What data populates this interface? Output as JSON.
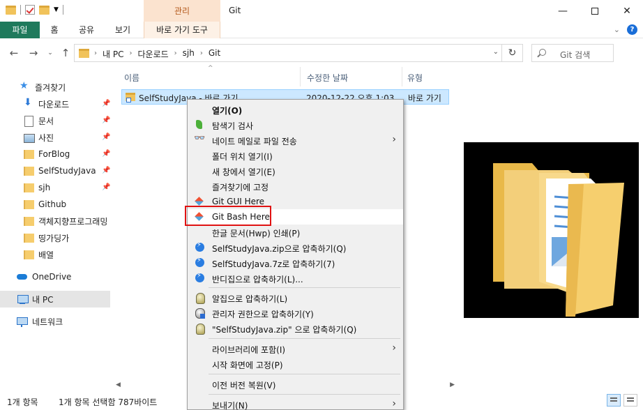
{
  "window": {
    "context_tab_title": "관리",
    "title": "Git",
    "minimize_icon": "minimize-icon",
    "maximize_icon": "maximize-icon",
    "close_icon": "close-icon"
  },
  "ribbon": {
    "tabs": [
      {
        "label": "파일"
      },
      {
        "label": "홈"
      },
      {
        "label": "공유"
      },
      {
        "label": "보기"
      },
      {
        "label": "바로 가기 도구"
      }
    ]
  },
  "address": {
    "crumbs": [
      "내 PC",
      "다운로드",
      "sjh",
      "Git"
    ],
    "search_placeholder": "Git 검색"
  },
  "sidebar": {
    "items": [
      {
        "label": "즐겨찾기",
        "icon": "star-icon"
      },
      {
        "label": "다운로드",
        "icon": "download-icon"
      },
      {
        "label": "문서",
        "icon": "document-icon"
      },
      {
        "label": "사진",
        "icon": "pictures-icon"
      },
      {
        "label": "ForBlog",
        "icon": "folder-icon"
      },
      {
        "label": "SelfStudyJava",
        "icon": "folder-icon"
      },
      {
        "label": "sjh",
        "icon": "folder-icon"
      },
      {
        "label": "Github",
        "icon": "folder-icon"
      },
      {
        "label": "객체지향프로그래밍",
        "icon": "folder-icon"
      },
      {
        "label": "띵가딩가",
        "icon": "folder-icon"
      },
      {
        "label": "배열",
        "icon": "folder-icon"
      },
      {
        "label": "OneDrive",
        "icon": "onedrive-icon"
      },
      {
        "label": "내 PC",
        "icon": "pc-icon"
      },
      {
        "label": "네트워크",
        "icon": "network-icon"
      }
    ]
  },
  "filelist": {
    "columns": [
      "이름",
      "수정한 날짜",
      "유형"
    ],
    "rows": [
      {
        "name": "SelfStudyJava - 바로 가기",
        "modified": "2020-12-22 오후 1:03",
        "type": "바로 가기"
      }
    ]
  },
  "status": {
    "count": "1개 항목",
    "selected": "1개 항목 선택함 787바이트"
  },
  "context_menu": {
    "items": [
      {
        "label": "열기(O)",
        "icon": ""
      },
      {
        "label": "탐색기 검사",
        "icon": "scan-icon"
      },
      {
        "label": "네이트 메일로 파일 전송",
        "icon": "nate-mail-icon"
      },
      {
        "label": "폴더 위치 열기(I)",
        "icon": ""
      },
      {
        "label": "새 창에서 열기(E)",
        "icon": ""
      },
      {
        "label": "즐겨찾기에 고정",
        "icon": ""
      },
      {
        "label": "Git GUI Here",
        "icon": "git-icon"
      },
      {
        "label": "Git Bash Here",
        "icon": "git-icon"
      },
      {
        "label": "한글 문서(Hwp) 인쇄(P)",
        "icon": ""
      },
      {
        "label": "SelfStudyJava.zip으로 압축하기(Q)",
        "icon": "bandizip-icon"
      },
      {
        "label": "SelfStudyJava.7z로 압축하기(7)",
        "icon": "bandizip-icon"
      },
      {
        "label": "반디집으로 압축하기(L)...",
        "icon": "bandizip-icon"
      },
      {
        "label": "알집으로 압축하기(L)",
        "icon": "alzip-icon"
      },
      {
        "label": "관리자 권한으로 압축하기(Y)",
        "icon": "alzip-admin-icon"
      },
      {
        "label": "\"SelfStudyJava.zip\" 으로 압축하기(Q)",
        "icon": "alzip-icon"
      },
      {
        "label": "라이브러리에 포함(I)",
        "icon": ""
      },
      {
        "label": "시작 화면에 고정(P)",
        "icon": ""
      },
      {
        "label": "이전 버전 복원(V)",
        "icon": ""
      },
      {
        "label": "보내기(N)",
        "icon": ""
      }
    ]
  }
}
